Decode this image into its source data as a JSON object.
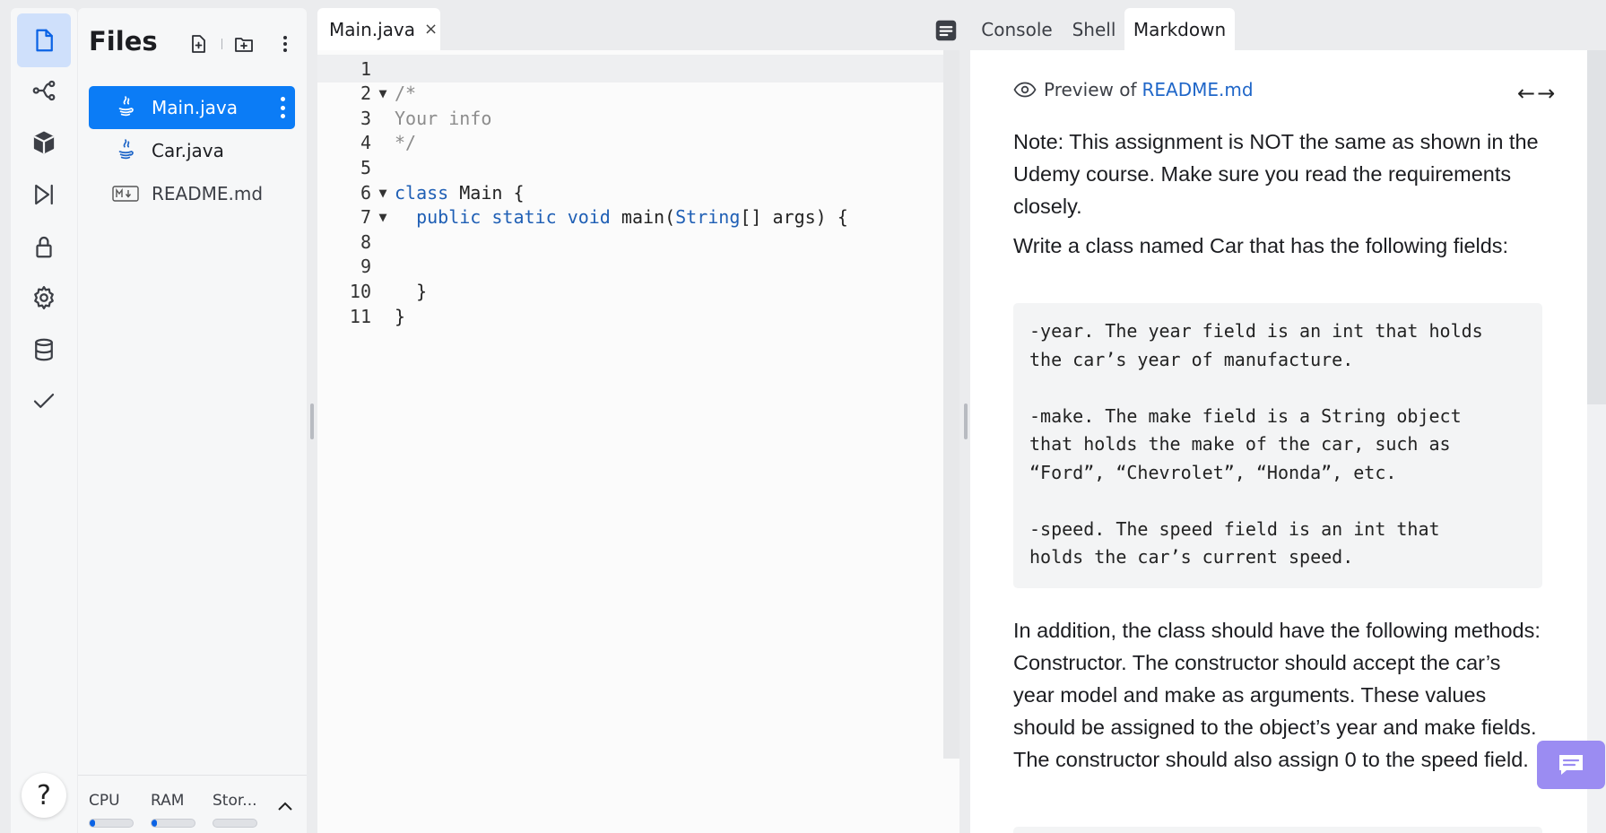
{
  "sidebar": {
    "rail_items": [
      "files-icon",
      "git-icon",
      "packages-icon",
      "debugger-icon",
      "secrets-icon",
      "settings-icon",
      "database-icon",
      "checks-icon"
    ],
    "help_label": "?"
  },
  "files": {
    "title": "Files",
    "items": [
      {
        "name": "Main.java",
        "icon": "java-icon",
        "active": true
      },
      {
        "name": "Car.java",
        "icon": "java-icon",
        "active": false
      },
      {
        "name": "README.md",
        "icon": "markdown-icon",
        "active": false
      }
    ],
    "resources": {
      "cpu_label": "CPU",
      "ram_label": "RAM",
      "storage_label": "Stor...",
      "cpu_usage": 0.1,
      "ram_usage": 0.1,
      "storage_usage": 0.0
    }
  },
  "editor": {
    "tab_label": "Main.java",
    "tab_close": "×",
    "lines": [
      {
        "num": "1",
        "fold": "",
        "code": ""
      },
      {
        "num": "2",
        "fold": "▼",
        "code": "/*"
      },
      {
        "num": "3",
        "fold": "",
        "code": "Your info"
      },
      {
        "num": "4",
        "fold": "",
        "code": "*/"
      },
      {
        "num": "5",
        "fold": "",
        "code": ""
      },
      {
        "num": "6",
        "fold": "▼",
        "code": "class Main {"
      },
      {
        "num": "7",
        "fold": "▼",
        "code": "  public static void main(String[] args) {"
      },
      {
        "num": "8",
        "fold": "",
        "code": ""
      },
      {
        "num": "9",
        "fold": "",
        "code": ""
      },
      {
        "num": "10",
        "fold": "",
        "code": "  }"
      },
      {
        "num": "11",
        "fold": "",
        "code": "}"
      }
    ]
  },
  "right_panel": {
    "tabs": [
      "Console",
      "Shell",
      "Markdown"
    ],
    "active_tab": "Markdown",
    "preview_prefix": "Preview of",
    "preview_file": "README.md",
    "nav_arrows": "←→",
    "para1": "Note: This assignment is NOT the same as shown in the Udemy course. Make sure you read the requirements closely.",
    "para2": "Write a class named Car that has the following fields:",
    "code_block": "-year. The year field is an int that holds\nthe car’s year of manufacture.\n\n-make. The make field is a String object\nthat holds the make of the car, such as\n“Ford”, “Chevrolet”, “Honda”, etc.\n\n-speed. The speed field is an int that\nholds the car’s current speed.",
    "para3": "In addition, the class should have the following methods: Constructor. The constructor should accept the car’s year model and make as arguments. These values should be assigned to the object’s year and make fields. The constructor should also assign 0 to the speed field."
  },
  "colors": {
    "accent": "#0b7cf6",
    "link": "#1f66c8",
    "chat_button": "#9b8cf2"
  }
}
